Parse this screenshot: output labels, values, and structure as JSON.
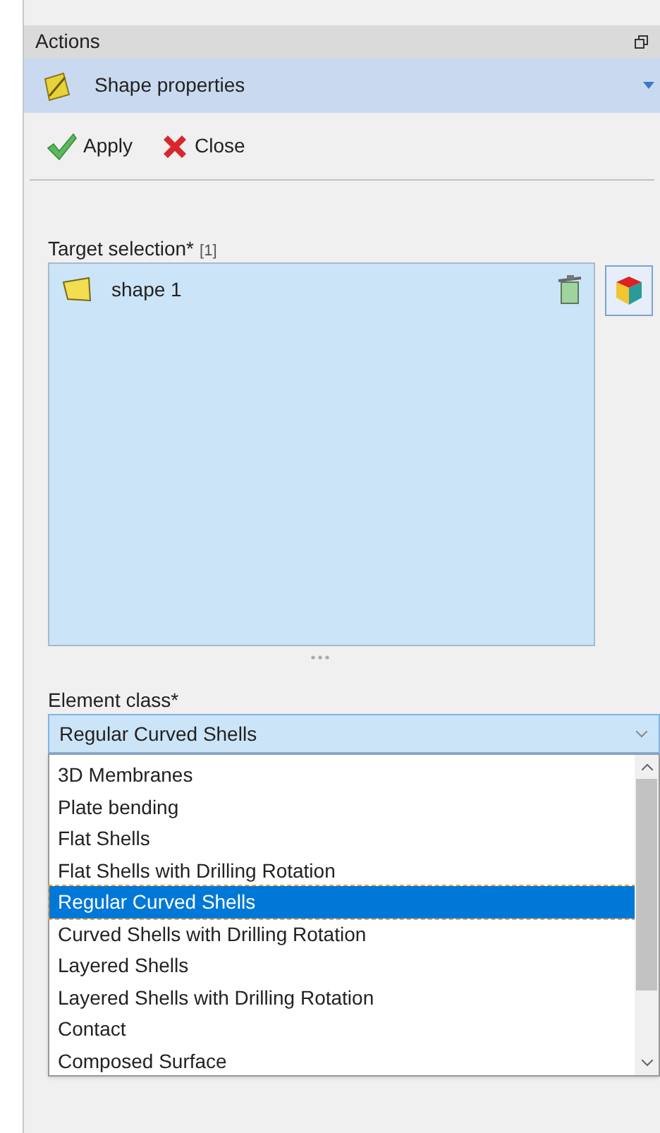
{
  "panel": {
    "title": "Actions"
  },
  "section": {
    "title": "Shape properties",
    "expanded": true
  },
  "toolbar": [
    {
      "kind": "apply",
      "label": "Apply"
    },
    {
      "kind": "close",
      "label": "Close"
    }
  ],
  "target_selection": {
    "label": "Target selection*",
    "count": "[1]",
    "items": [
      {
        "label": "shape 1"
      }
    ]
  },
  "element_class": {
    "label": "Element class*",
    "value": "Regular Curved Shells",
    "expanded": true,
    "options": [
      {
        "label": "3D Membranes",
        "selected": false
      },
      {
        "label": "Plate bending",
        "selected": false
      },
      {
        "label": "Flat Shells",
        "selected": false
      },
      {
        "label": "Flat Shells with Drilling Rotation",
        "selected": false
      },
      {
        "label": "Regular Curved Shells",
        "selected": true
      },
      {
        "label": "Curved Shells with Drilling Rotation",
        "selected": false
      },
      {
        "label": "Layered Shells",
        "selected": false
      },
      {
        "label": "Layered Shells with Drilling Rotation",
        "selected": false
      },
      {
        "label": "Contact",
        "selected": false
      },
      {
        "label": "Composed Surface",
        "selected": false
      }
    ]
  }
}
